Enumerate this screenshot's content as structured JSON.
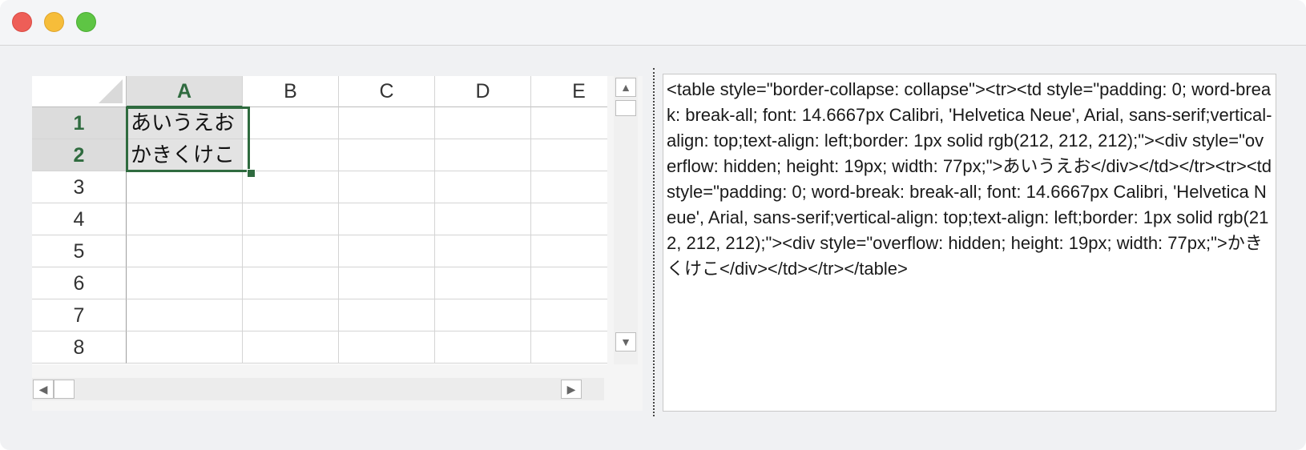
{
  "window": {
    "controls": [
      "close",
      "minimize",
      "zoom"
    ]
  },
  "spreadsheet": {
    "columns": [
      "A",
      "B",
      "C",
      "D",
      "E"
    ],
    "active_column": "A",
    "rows": [
      "1",
      "2",
      "3",
      "4",
      "5",
      "6",
      "7",
      "8"
    ],
    "active_rows": [
      "1",
      "2"
    ],
    "cells": {
      "A1": "あいうえお",
      "A2": "かきくけこ"
    }
  },
  "scrollbars": {
    "up_arrow": "▲",
    "down_arrow": "▼",
    "left_arrow": "◀",
    "right_arrow": "▶"
  },
  "html_output": {
    "text": "<table style=\"border-collapse: collapse\"><tr><td style=\"padding: 0; word-break: break-all; font: 14.6667px Calibri, 'Helvetica Neue', Arial, sans-serif;vertical-align: top;text-align: left;border: 1px solid rgb(212, 212, 212);\"><div style=\"overflow: hidden; height: 19px; width: 77px;\">あいうえお</div></td></tr><tr><td style=\"padding: 0; word-break: break-all; font: 14.6667px Calibri, 'Helvetica Neue', Arial, sans-serif;vertical-align: top;text-align: left;border: 1px solid rgb(212, 212, 212);\"><div style=\"overflow: hidden; height: 19px; width: 77px;\">かきくけこ</div></td></tr></table>"
  },
  "colors": {
    "selection_border": "#2f6b3f",
    "active_header_bg": "#e0e0e0",
    "grid_line": "#d4d4d4"
  }
}
